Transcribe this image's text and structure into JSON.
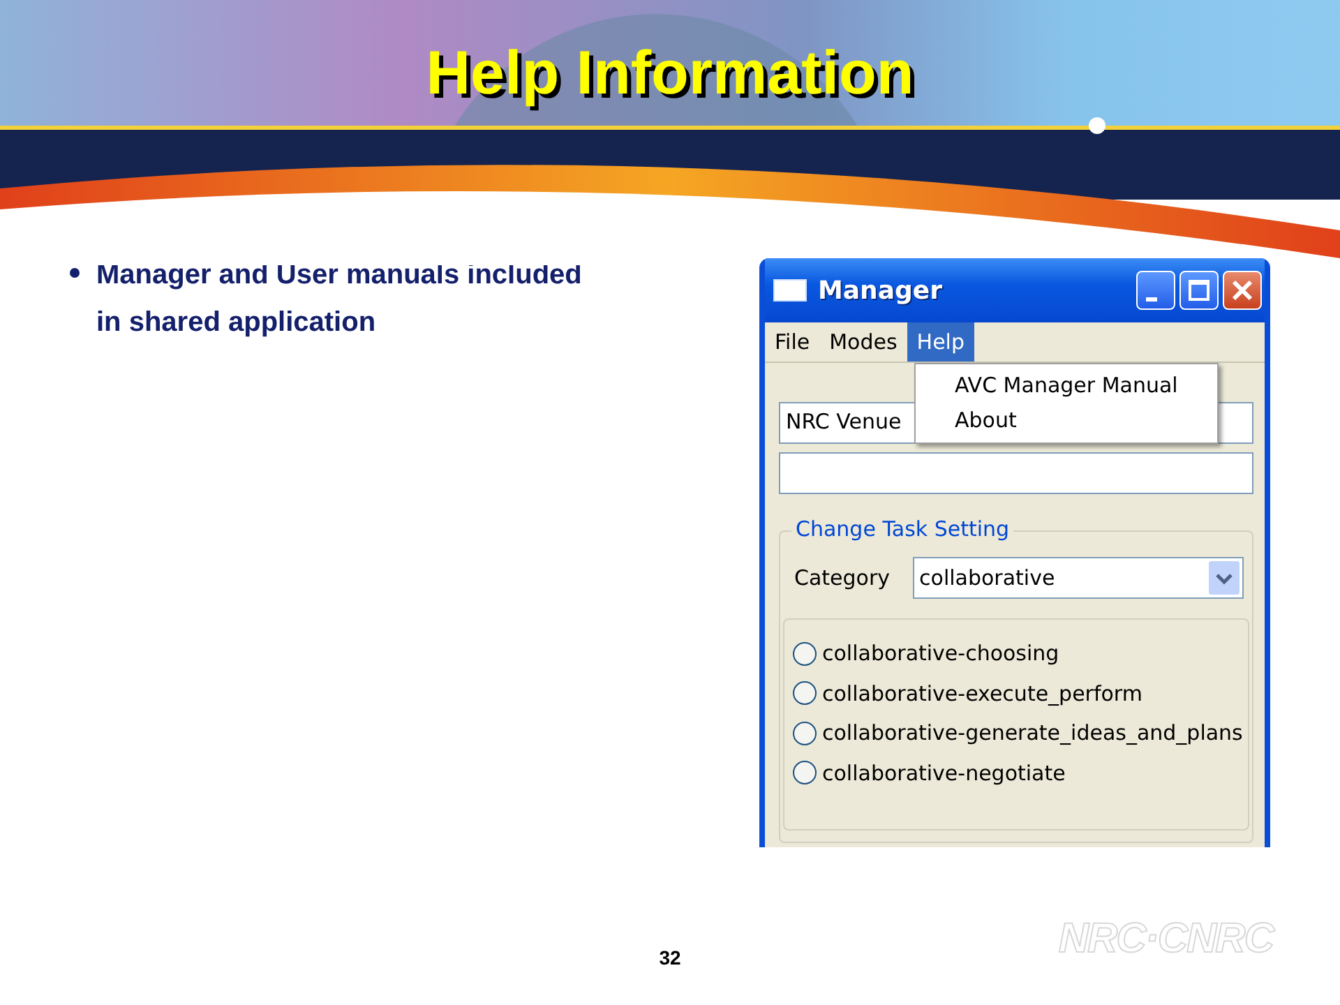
{
  "slide": {
    "title": "Help Information",
    "bullets": [
      "Manager and User manuals included in shared application"
    ],
    "page_number": "32",
    "logo": "NRC·CNRC"
  },
  "window": {
    "title": "Manager",
    "menu": [
      {
        "label": "File",
        "selected": false
      },
      {
        "label": "Modes",
        "selected": false
      },
      {
        "label": "Help",
        "selected": true
      }
    ],
    "dropdown": [
      "AVC Manager Manual",
      "About"
    ],
    "venue_field": {
      "value": "NRC Venue"
    },
    "group": {
      "title": "Change Task Setting",
      "category_label": "Category",
      "category_value": "collaborative",
      "options": [
        {
          "label": "collaborative-choosing",
          "selected": false
        },
        {
          "label": "collaborative-execute_perform",
          "selected": false
        },
        {
          "label": "collaborative-generate_ideas_and_plans",
          "selected": false
        },
        {
          "label": "collaborative-negotiate",
          "selected": false
        }
      ]
    }
  }
}
